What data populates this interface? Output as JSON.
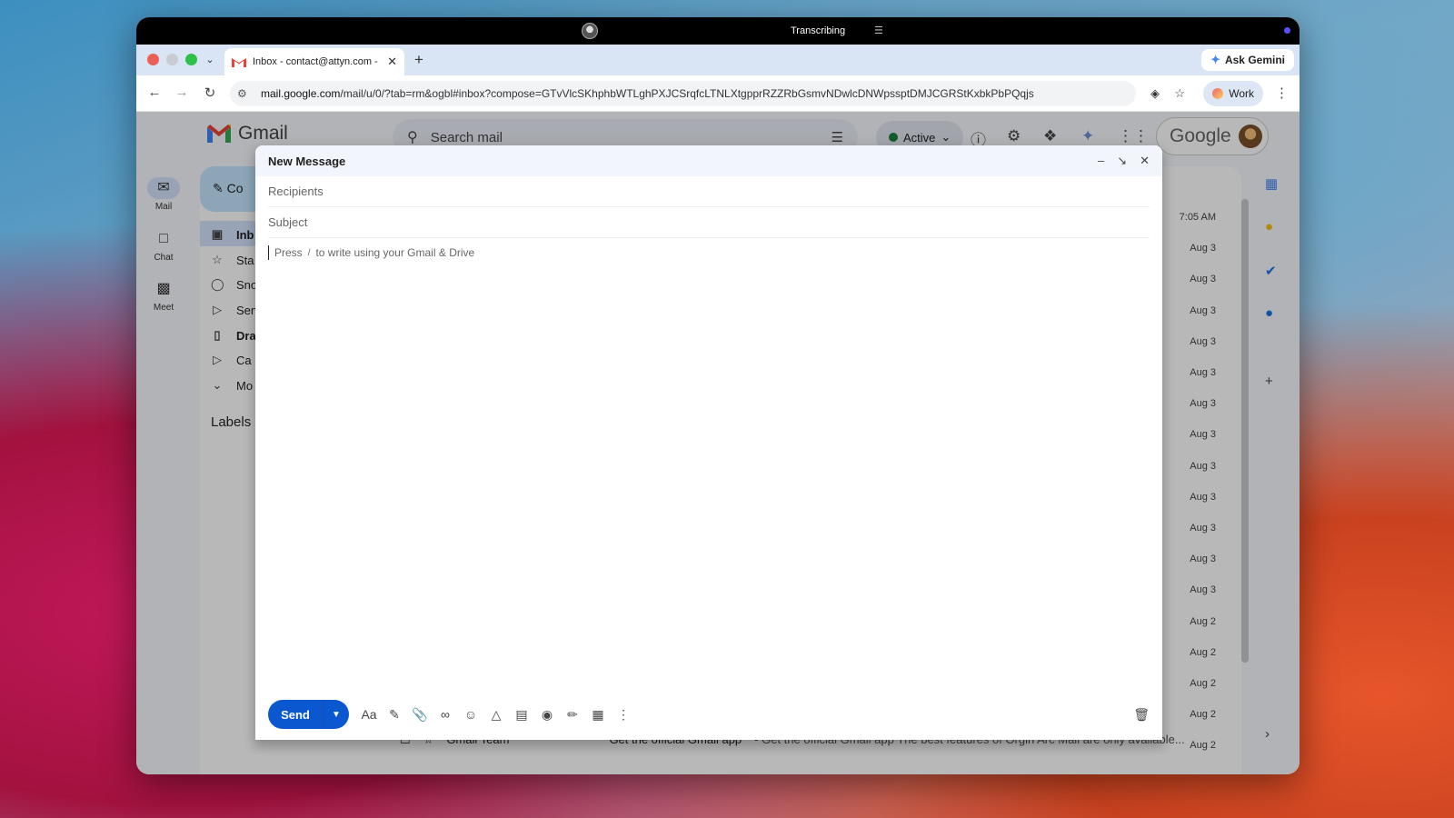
{
  "system_bar": {
    "status": "Transcribing"
  },
  "browser": {
    "tab_title": "Inbox - contact@attyn.com -",
    "gemini_label": "Ask Gemini",
    "url_host": "mail.google.com",
    "url_path": "/mail/u/0/?tab=rm&ogbl#inbox?compose=GTvVlcSKhphbWTLghPXJCSrqfcLTNLXtgpprRZZRbGsmvNDwlcDNWpssptDMJCGRStKxbkPbPQqjs",
    "profile_label": "Work"
  },
  "gmail": {
    "logo_text": "Gmail",
    "search_placeholder": "Search mail",
    "status": "Active",
    "google_text": "Google",
    "rail": [
      {
        "label": "Mail",
        "icon": "mail-icon"
      },
      {
        "label": "Chat",
        "icon": "chat-icon"
      },
      {
        "label": "Meet",
        "icon": "meet-icon"
      }
    ],
    "compose_partial": "Co",
    "nav": [
      {
        "label": "Inb",
        "icon": "inbox-icon",
        "bold": true
      },
      {
        "label": "Sta",
        "icon": "star-icon"
      },
      {
        "label": "Sno",
        "icon": "clock-icon"
      },
      {
        "label": "Sen",
        "icon": "send-icon"
      },
      {
        "label": "Dra",
        "icon": "draft-icon",
        "bold": true
      },
      {
        "label": "Ca",
        "icon": "label-icon"
      },
      {
        "label": "Mo",
        "icon": "chevron-down-icon"
      }
    ],
    "labels_heading": "Labels",
    "dates": [
      "7:05 AM",
      "Aug 3",
      "Aug 3",
      "Aug 3",
      "Aug 3",
      "Aug 3",
      "Aug 3",
      "Aug 3",
      "Aug 3",
      "Aug 3",
      "Aug 3",
      "Aug 3",
      "Aug 3",
      "Aug 2",
      "Aug 2",
      "Aug 2",
      "Aug 2",
      "Aug 2"
    ],
    "last_row": {
      "sender": "Gmail Team",
      "subject": "Get the official Gmail app",
      "snippet": "- Get the official Gmail app The best features of Orgin Arc Mail are only available..."
    }
  },
  "compose": {
    "title": "New Message",
    "recipients_placeholder": "Recipients",
    "subject_placeholder": "Subject",
    "body_hint_pre": "Press",
    "body_hint_key": "/",
    "body_hint_post": "to write using your Gmail & Drive",
    "send_label": "Send",
    "format_label": "Aa"
  }
}
